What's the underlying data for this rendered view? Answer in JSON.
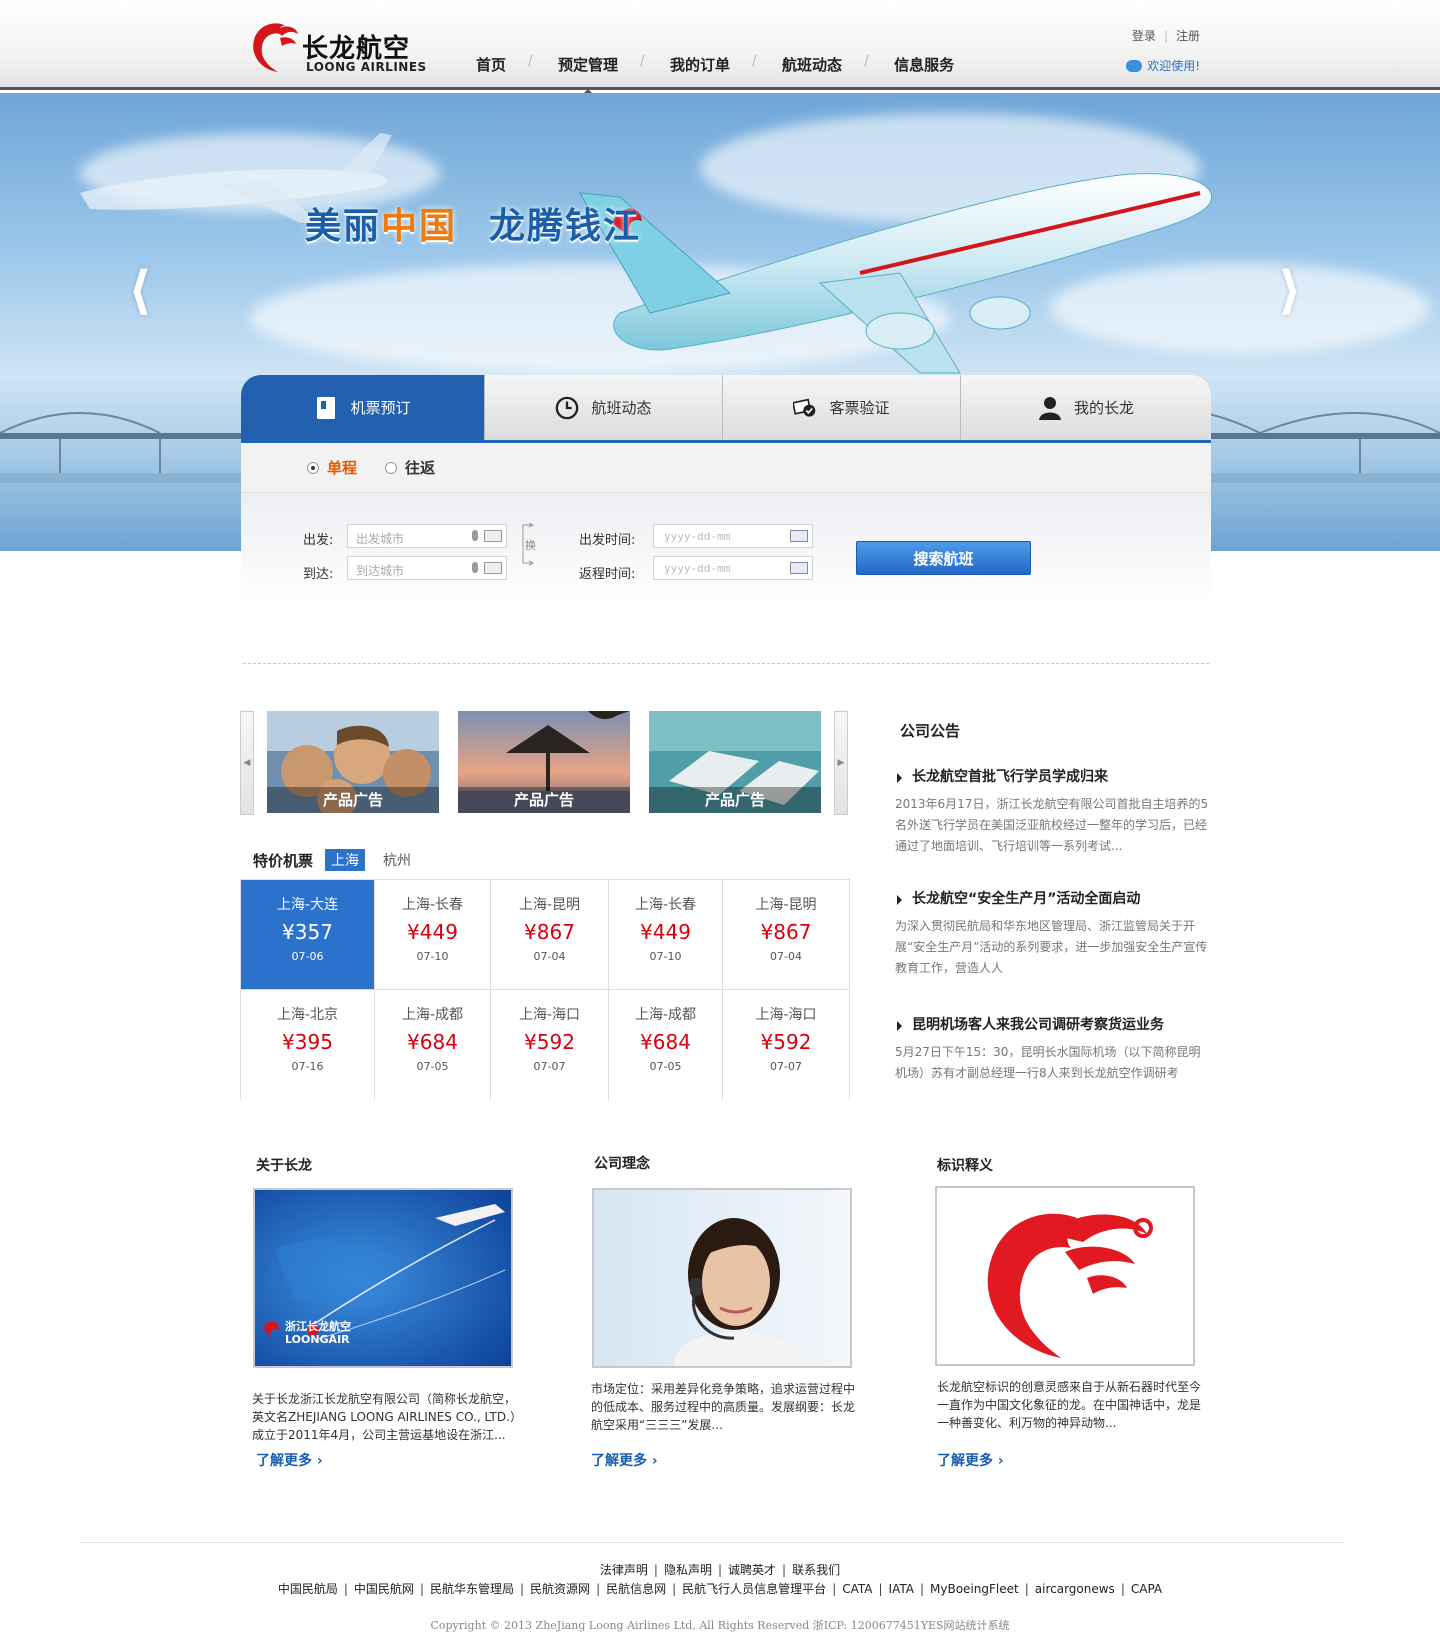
{
  "header": {
    "logo_cn": "长龙航空",
    "logo_en": "LOONG AIRLINES",
    "nav": [
      "首页",
      "预定管理",
      "我的订单",
      "航班动态",
      "信息服务"
    ],
    "login": "登录",
    "register": "注册",
    "welcome": "欢迎使用!"
  },
  "banner": {
    "slogan_a1": "美丽",
    "slogan_a2": "中国",
    "slogan_b": "龙腾钱江",
    "prev": "⟨",
    "next": "⟩"
  },
  "booking": {
    "tabs": [
      "机票预订",
      "航班动态",
      "客票验证",
      "我的长龙"
    ],
    "trip_one_way": "单程",
    "trip_round": "往返",
    "from_label": "出发:",
    "to_label": "到达:",
    "from_placeholder": "出发城市",
    "to_placeholder": "到达城市",
    "depart_label": "出发时间:",
    "return_label": "返程时间:",
    "date_placeholder": "yyyy-dd-mm",
    "swap": "换",
    "search": "搜索航班"
  },
  "products": {
    "labels": [
      "产品广告",
      "产品广告",
      "产品广告"
    ]
  },
  "fares": {
    "title": "特价机票",
    "cities": [
      "上海",
      "杭州"
    ],
    "rows": [
      [
        {
          "route": "上海-大连",
          "price": "¥357",
          "date": "07-06"
        },
        {
          "route": "上海-长春",
          "price": "¥449",
          "date": "07-10"
        },
        {
          "route": "上海-昆明",
          "price": "¥867",
          "date": "07-04"
        },
        {
          "route": "上海-长春",
          "price": "¥449",
          "date": "07-10"
        },
        {
          "route": "上海-昆明",
          "price": "¥867",
          "date": "07-04"
        }
      ],
      [
        {
          "route": "上海-北京",
          "price": "¥395",
          "date": "07-16"
        },
        {
          "route": "上海-成都",
          "price": "¥684",
          "date": "07-05"
        },
        {
          "route": "上海-海口",
          "price": "¥592",
          "date": "07-07"
        },
        {
          "route": "上海-成都",
          "price": "¥684",
          "date": "07-05"
        },
        {
          "route": "上海-海口",
          "price": "¥592",
          "date": "07-07"
        }
      ]
    ]
  },
  "notices": {
    "title": "公司公告",
    "items": [
      {
        "title": "长龙航空首批飞行学员学成归来",
        "body": "2013年6月17日，浙江长龙航空有限公司首批自主培养的5名外送飞行学员在美国泛亚航校经过一整年的学习后，已经通过了地面培训、飞行培训等一系列考试..."
      },
      {
        "title": "长龙航空“安全生产月”活动全面启动",
        "body": "为深入贯彻民航局和华东地区管理局、浙江监管局关于开展“安全生产月”活动的系列要求，进一步加强安全生产宣传教育工作，营造人人"
      },
      {
        "title": "昆明机场客人来我公司调研考察货运业务",
        "body": "5月27日下午15：30，昆明长水国际机场（以下简称昆明机场）苏有才副总经理一行8人来到长龙航空作调研考"
      }
    ]
  },
  "about": {
    "items": [
      {
        "title": "关于长龙",
        "text": "关于长龙浙江长龙航空有限公司（简称长龙航空，英文名ZHEJIANG LOONG AIRLINES CO., LTD.）成立于2011年4月，公司主营运基地设在浙江...",
        "more": "了解更多 ›",
        "img_cn": "浙江长龙航空",
        "img_en": "LOONGAIR"
      },
      {
        "title": "公司理念",
        "text": "市场定位：采用差异化竞争策略，追求运营过程中的低成本、服务过程中的高质量。发展纲要：长龙航空采用“三三三”发展...",
        "more": "了解更多 ›"
      },
      {
        "title": "标识释义",
        "text": "长龙航空标识的创意灵感来自于从新石器时代至今一直作为中国文化象征的龙。在中国神话中，龙是一种善变化、利万物的神异动物...",
        "more": "了解更多 ›"
      }
    ]
  },
  "footer": {
    "links1": [
      "法律声明",
      "隐私声明",
      "诚聘英才",
      "联系我们"
    ],
    "links2": [
      "中国民航局",
      "中国民航网",
      "民航华东管理局",
      "民航资源网",
      "民航信息网",
      "民航飞行人员信息管理平台",
      "CATA",
      "IATA",
      "MyBoeingFleet",
      "aircargonews",
      "CAPA"
    ],
    "copyright": "Copyright © 2013 ZheJiang Loong Airlines Ltd, All Rights Reserved 浙ICP: 1200677451YES网站统计系统"
  },
  "colors": {
    "brand_blue": "#2460b0",
    "price_red": "#d9000e",
    "accent_orange": "#f07a0c",
    "logo_red": "#d4161c"
  }
}
